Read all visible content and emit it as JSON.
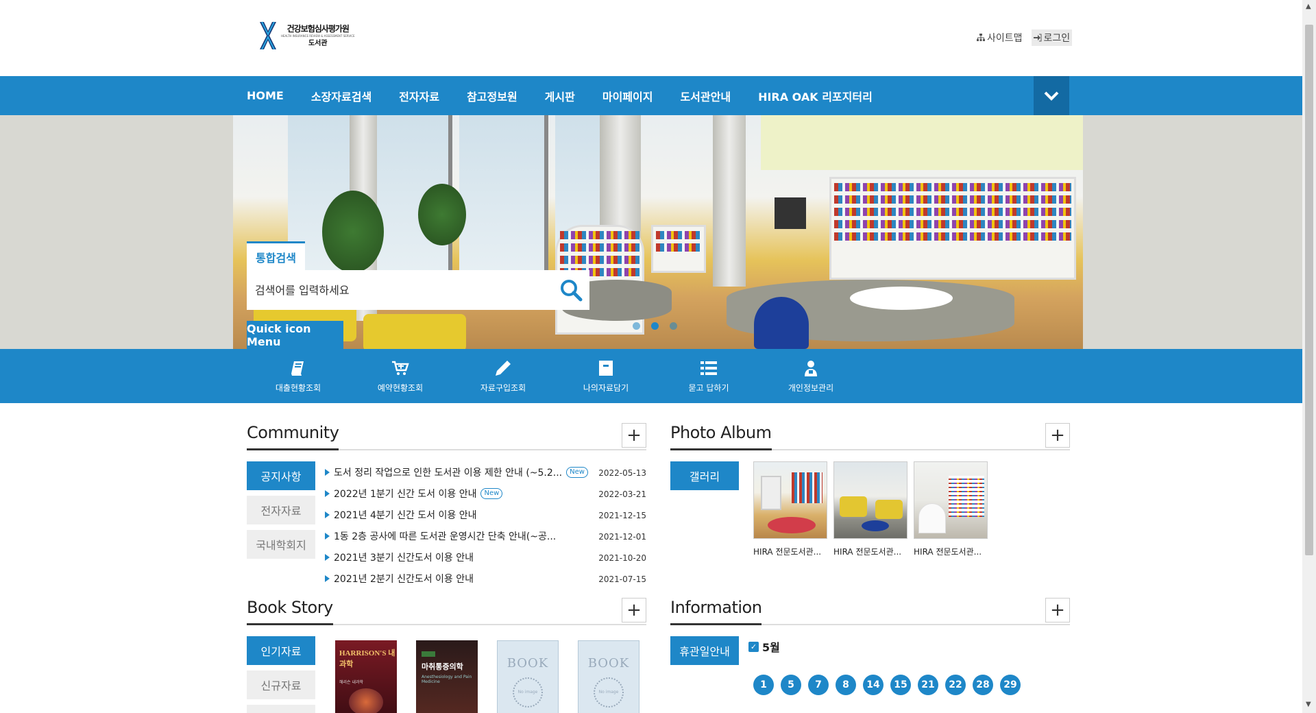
{
  "logo": {
    "main": "건강보험심사평가원",
    "sub": "HEALTH INSURANCE REVIEW & ASSESSMENT SERVICE",
    "lib": "도서관"
  },
  "util": {
    "sitemap": "사이트맵",
    "login": "로그인"
  },
  "nav": {
    "items": [
      "HOME",
      "소장자료검색",
      "전자자료",
      "참고정보원",
      "게시판",
      "마이페이지",
      "도서관안내",
      "HIRA OAK 리포지터리"
    ]
  },
  "search": {
    "tab": "통합검색",
    "placeholder": "검색어를 입력하세요"
  },
  "quick": {
    "tab": "Quick icon Menu",
    "items": [
      "대출현황조회",
      "예약현황조회",
      "자료구입조회",
      "나의자료담기",
      "묻고 답하기",
      "개인정보관리"
    ]
  },
  "community": {
    "title": "Community",
    "tabs": [
      "공지사항",
      "전자자료",
      "국내학회지"
    ],
    "notices": [
      {
        "title": "도서 정리 작업으로 인한 도서관 이용 제한 안내 (~5.2...",
        "badge": "New",
        "date": "2022-05-13"
      },
      {
        "title": "2022년 1분기 신간 도서 이용 안내",
        "badge": "New",
        "date": "2022-03-21"
      },
      {
        "title": "2021년 4분기 신간 도서 이용 안내",
        "badge": "",
        "date": "2021-12-15"
      },
      {
        "title": "1동 2층 공사에 따른 도서관 운영시간 단축 안내(~공...",
        "badge": "",
        "date": "2021-12-01"
      },
      {
        "title": "2021년 3분기 신간도서 이용 안내",
        "badge": "",
        "date": "2021-10-20"
      },
      {
        "title": "2021년 2분기 신간도서 이용 안내",
        "badge": "",
        "date": "2021-07-15"
      }
    ]
  },
  "album": {
    "title": "Photo Album",
    "tab": "갤러리",
    "items": [
      "HIRA 전문도서관...",
      "HIRA 전문도서관...",
      "HIRA 전문도서관..."
    ]
  },
  "bookstory": {
    "title": "Book Story",
    "tabs": [
      "인기자료",
      "신규자료"
    ],
    "books": [
      {
        "title": "HARRISON'S 내과학",
        "subtitle": "해리슨 내과학"
      },
      {
        "title": "마취통증의학",
        "subtitle": "Anesthesiology and Pain Medicine"
      },
      {
        "title": "BOOK",
        "subtitle": "No image"
      },
      {
        "title": "BOOK",
        "subtitle": "No image"
      }
    ]
  },
  "info": {
    "title": "Information",
    "tab": "휴관일안내",
    "month": "5월",
    "days": [
      "1",
      "5",
      "7",
      "8",
      "14",
      "15",
      "21",
      "22",
      "28",
      "29"
    ]
  },
  "colors": {
    "accent": "#1e87c8",
    "accent_dark": "#136aa3"
  }
}
